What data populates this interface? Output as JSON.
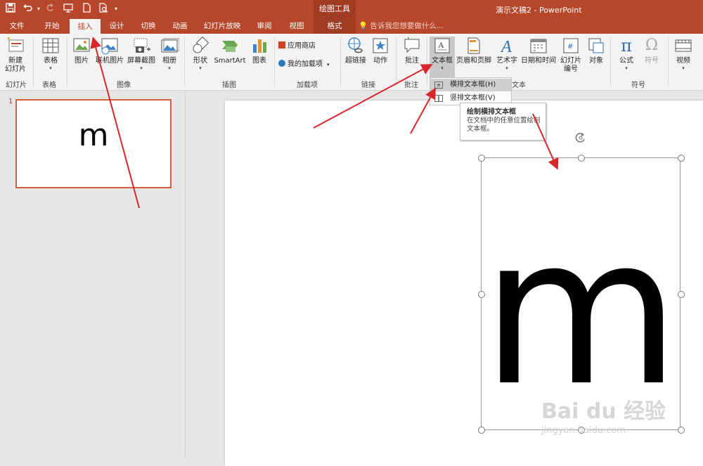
{
  "titlebar": {
    "context_group": "绘图工具",
    "title": "演示文稿2 - PowerPoint",
    "qat_icons": [
      "save-icon",
      "undo-icon",
      "redo-icon",
      "slideshow-from-start-icon",
      "new-file-icon",
      "print-preview-icon",
      "customize-qat-icon"
    ]
  },
  "tabs": [
    {
      "label": "文件"
    },
    {
      "label": "开始"
    },
    {
      "label": "插入",
      "active": true
    },
    {
      "label": "设计"
    },
    {
      "label": "切换"
    },
    {
      "label": "动画"
    },
    {
      "label": "幻灯片放映"
    },
    {
      "label": "审阅"
    },
    {
      "label": "视图"
    },
    {
      "label": "格式",
      "contextual": true
    }
  ],
  "tell_me": "告诉我您想要做什么...",
  "ribbon": {
    "new_slide": {
      "line1": "新建",
      "line2": "幻灯片"
    },
    "table": "表格",
    "picture": "图片",
    "online_picture": "联机图片",
    "screenshot": "屏幕截图",
    "album": "相册",
    "shapes": "形状",
    "smartart": "SmartArt",
    "chart": "图表",
    "store": "应用商店",
    "my_addins": "我的加载项",
    "hyperlink": "超链接",
    "action": "动作",
    "comment": "批注",
    "textbox": "文本框",
    "header_footer": "页眉和页脚",
    "wordart": "艺术字",
    "datetime": "日期和时间",
    "slide_number": {
      "line1": "幻灯片",
      "line2": "编号"
    },
    "object": "对象",
    "equation": "公式",
    "symbol": "符号",
    "video": "视频",
    "groups": {
      "slides": "幻灯片",
      "tables": "表格",
      "images": "图像",
      "illustrations": "插图",
      "addins": "加载项",
      "links": "链接",
      "comments": "批注",
      "text": "文本",
      "symbols": "符号"
    }
  },
  "textbox_menu": {
    "horizontal": "横排文本框(H)",
    "vertical": "竖排文本框(V)"
  },
  "tooltip": {
    "title": "绘制横排文本框",
    "body": "在文档中的任意位置绘制文本框。"
  },
  "slides_pane": {
    "slide_number": "1",
    "thumbnail_text": "m"
  },
  "slide": {
    "textbox_text": "m"
  },
  "watermark": {
    "main": "Bai du 经验",
    "sub": "jingyan.baidu.com"
  },
  "colors": {
    "accent": "#b7472a",
    "arrow": "#d9262c"
  }
}
